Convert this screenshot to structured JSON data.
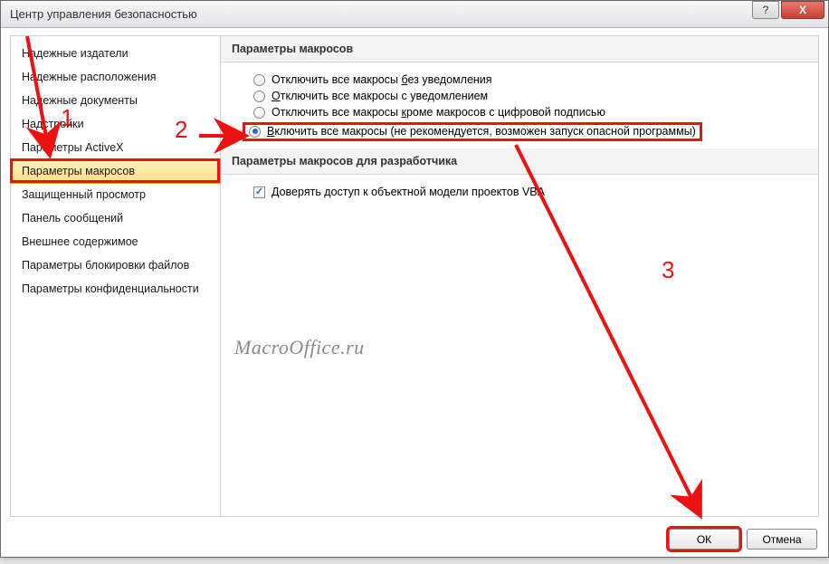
{
  "window": {
    "title": "Центр управления безопасностью"
  },
  "titlebar": {
    "help": "?",
    "close": "X"
  },
  "sidebar": {
    "items": [
      {
        "label": "Надежные издатели"
      },
      {
        "label": "Надежные расположения"
      },
      {
        "label": "Надежные документы"
      },
      {
        "label": "Надстройки"
      },
      {
        "label": "Параметры ActiveX"
      },
      {
        "label": "Параметры макросов",
        "selected": true
      },
      {
        "label": "Защищенный просмотр"
      },
      {
        "label": "Панель сообщений"
      },
      {
        "label": "Внешнее содержимое"
      },
      {
        "label": "Параметры блокировки файлов"
      },
      {
        "label": "Параметры конфиденциальности"
      }
    ]
  },
  "groups": {
    "macros": {
      "title": "Параметры макросов",
      "options": [
        {
          "label": "Отключить все макросы без уведомления",
          "checked": false,
          "u": "б"
        },
        {
          "label": "Отключить все макросы с уведомлением",
          "checked": false,
          "u": "О"
        },
        {
          "label": "Отключить все макросы кроме макросов с цифровой подписью",
          "checked": false,
          "u": "к"
        },
        {
          "label": "Включить все макросы (не рекомендуется, возможен запуск опасной программы)",
          "checked": true,
          "u": "В"
        }
      ]
    },
    "developer": {
      "title": "Параметры макросов для разработчика",
      "trust_vba_label": "Доверять доступ к объектной модели проектов VBA",
      "trust_vba_u": "Д",
      "trust_vba_checked": true
    }
  },
  "footer": {
    "ok": "ОК",
    "cancel": "Отмена"
  },
  "watermark": "MacroOffice.ru",
  "annotations": {
    "n1": "1",
    "n2": "2",
    "n3": "3"
  }
}
